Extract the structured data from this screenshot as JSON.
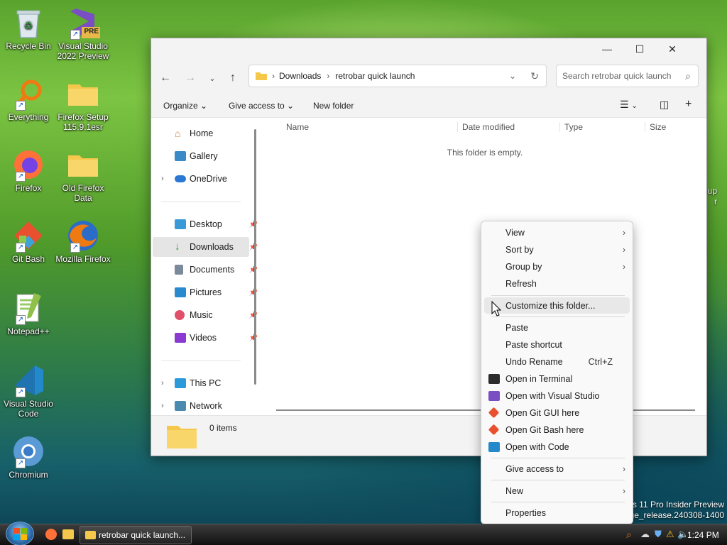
{
  "desktop": {
    "icons": [
      {
        "label": "Recycle Bin"
      },
      {
        "label": "Visual Studio 2022 Preview",
        "badge": "PRE"
      },
      {
        "label": "Everything"
      },
      {
        "label": "Firefox Setup 115.9.1esr"
      },
      {
        "label": "Firefox"
      },
      {
        "label": "Old Firefox Data"
      },
      {
        "label": "Git Bash"
      },
      {
        "label": "Mozilla Firefox"
      },
      {
        "label": "Notepad++"
      },
      {
        "label": "Visual Studio Code"
      },
      {
        "label": "Chromium"
      }
    ],
    "partial_icon_label": "up\nr",
    "watermark": {
      "line1": "ws 11 Pro Insider Preview",
      "line2": "0.ge_release.240308-1400"
    }
  },
  "window": {
    "controls": {
      "minimize": "—",
      "maximize": "☐",
      "close": "✕"
    },
    "breadcrumb": [
      "Downloads",
      "retrobar quick launch"
    ],
    "search_placeholder": "Search retrobar quick launch",
    "commands": {
      "organize": "Organize",
      "give_access": "Give access to",
      "new_folder": "New folder"
    },
    "nav": {
      "quick": [
        "Home",
        "Gallery",
        "OneDrive"
      ],
      "pinned": [
        "Desktop",
        "Downloads",
        "Documents",
        "Pictures",
        "Music",
        "Videos"
      ],
      "bottom": [
        "This PC",
        "Network"
      ]
    },
    "columns": [
      "Name",
      "Date modified",
      "Type",
      "Size"
    ],
    "empty_message": "This folder is empty.",
    "status": "0 items"
  },
  "context_menu": {
    "items": [
      {
        "label": "View",
        "submenu": true
      },
      {
        "label": "Sort by",
        "submenu": true
      },
      {
        "label": "Group by",
        "submenu": true
      },
      {
        "label": "Refresh"
      },
      {
        "label": "Customize this folder..."
      },
      {
        "label": "Paste"
      },
      {
        "label": "Paste shortcut"
      },
      {
        "label": "Undo Rename",
        "shortcut": "Ctrl+Z"
      },
      {
        "label": "Open in Terminal"
      },
      {
        "label": "Open with Visual Studio"
      },
      {
        "label": "Open Git GUI here"
      },
      {
        "label": "Open Git Bash here"
      },
      {
        "label": "Open with Code"
      },
      {
        "label": "Give access to",
        "submenu": true
      },
      {
        "label": "New",
        "submenu": true
      },
      {
        "label": "Properties"
      }
    ]
  },
  "taskbar": {
    "task_label": "retrobar quick launch...",
    "clock": "1:24 PM"
  }
}
